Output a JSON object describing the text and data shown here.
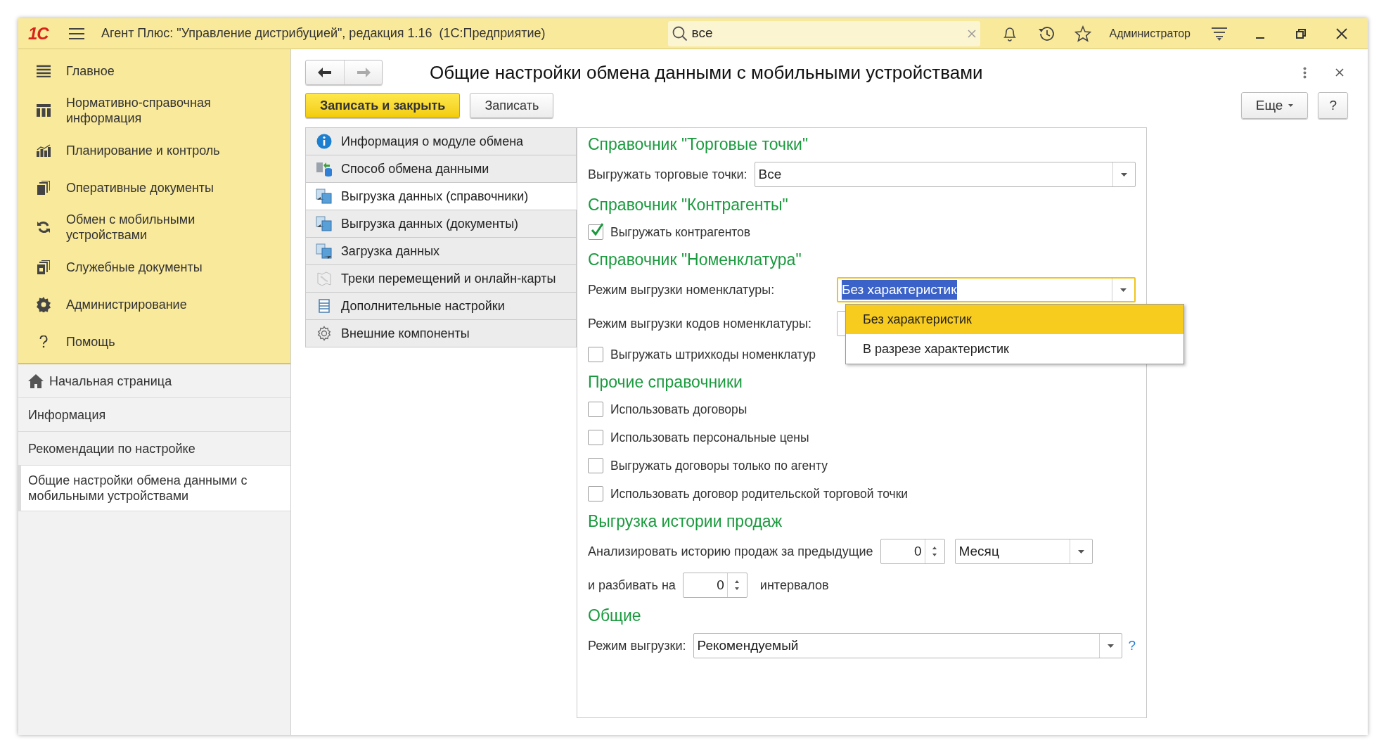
{
  "title_bar": {
    "logo": "1С",
    "app_title": "Агент Плюс: \"Управление дистрибуцией\", редакция 1.16  (1С:Предприятие)",
    "search": {
      "value": "все"
    },
    "user": "Администратор"
  },
  "sidebar": {
    "sections": [
      {
        "label": "Главное"
      },
      {
        "label": "Нормативно-справочная информация"
      },
      {
        "label": "Планирование и контроль"
      },
      {
        "label": "Оперативные документы"
      },
      {
        "label": "Обмен с мобильными устройствами"
      },
      {
        "label": "Служебные документы"
      },
      {
        "label": "Администрирование"
      },
      {
        "label": "Помощь"
      }
    ],
    "open_pages": [
      {
        "label": "Начальная страница",
        "selected": false
      },
      {
        "label": "Информация",
        "selected": false
      },
      {
        "label": "Рекомендации по настройке",
        "selected": false
      },
      {
        "label": "Общие настройки обмена данными с мобильными устройствами",
        "selected": true
      }
    ]
  },
  "form": {
    "title": "Общие настройки обмена данными с мобильными устройствами",
    "nav": [
      {
        "kind": "back",
        "disabled": false
      },
      {
        "kind": "forward",
        "disabled": true
      }
    ],
    "buttons": [
      {
        "label": "Записать и закрыть",
        "primary": true
      },
      {
        "label": "Записать",
        "primary": false
      }
    ],
    "right_buttons": [
      {
        "label": "Еще",
        "menu": true
      },
      {
        "label": "?",
        "menu": false
      }
    ],
    "tabs": [
      {
        "label": "Информация о модуле обмена",
        "selected": false
      },
      {
        "label": "Способ обмена данными",
        "selected": false
      },
      {
        "label": "Выгрузка данных (справочники)",
        "selected": true
      },
      {
        "label": "Выгрузка данных (документы)",
        "selected": false
      },
      {
        "label": "Загрузка данных",
        "selected": false
      },
      {
        "label": "Треки перемещений и онлайн-карты",
        "selected": false
      },
      {
        "label": "Дополнительные настройки",
        "selected": false
      },
      {
        "label": "Внешние компоненты",
        "selected": false
      }
    ],
    "rows": [
      {
        "kind": "heading",
        "text": "Справочник \"Торговые точки\""
      },
      {
        "kind": "line",
        "items": [
          {
            "kind": "label",
            "text": "Выгружать торговые точки:"
          },
          {
            "kind": "select",
            "value": "Все",
            "focused": false
          }
        ]
      },
      {
        "kind": "heading",
        "text": "Справочник \"Контрагенты\""
      },
      {
        "kind": "checkbox",
        "text": "Выгружать контрагентов",
        "checked": true
      },
      {
        "kind": "heading",
        "text": "Справочник \"Номенклатура\""
      },
      {
        "kind": "line",
        "items": [
          {
            "kind": "label",
            "text": "Режим выгрузки номенклатуры:"
          },
          {
            "kind": "select",
            "value": "Без характеристик",
            "focused": true,
            "options": [
              {
                "label": "Без характеристик",
                "selected": true
              },
              {
                "label": "В разрезе характеристик",
                "selected": false
              }
            ]
          }
        ]
      },
      {
        "kind": "line",
        "items": [
          {
            "kind": "label",
            "text": "Режим выгрузки кодов номенклатуры:"
          },
          {
            "kind": "select",
            "focused": false
          }
        ]
      },
      {
        "kind": "checkbox",
        "text": "Выгружать штрихкоды номенклатур",
        "checked": false
      },
      {
        "kind": "heading",
        "text": "Прочие справочники"
      },
      {
        "kind": "checkbox",
        "text": "Использовать договоры",
        "checked": false
      },
      {
        "kind": "checkbox",
        "text": "Использовать персональные цены",
        "checked": false
      },
      {
        "kind": "checkbox",
        "text": "Выгружать договоры только по агенту",
        "checked": false
      },
      {
        "kind": "checkbox",
        "text": "Использовать договор родительской торговой точки",
        "checked": false
      },
      {
        "kind": "heading",
        "text": "Выгрузка истории продаж"
      },
      {
        "kind": "line",
        "items": [
          {
            "kind": "label",
            "text": "Анализировать историю продаж за предыдущие"
          },
          {
            "kind": "spin",
            "value": "0"
          },
          {
            "kind": "select",
            "value": "Месяц",
            "focused": false
          }
        ]
      },
      {
        "kind": "line",
        "items": [
          {
            "kind": "label",
            "text": "и разбивать на"
          },
          {
            "kind": "spin",
            "value": "0"
          },
          {
            "kind": "label",
            "text": "интервалов"
          }
        ]
      },
      {
        "kind": "heading",
        "text": "Общие"
      },
      {
        "kind": "line",
        "items": [
          {
            "kind": "label",
            "text": "Режим выгрузки:"
          },
          {
            "kind": "select",
            "value": "Рекомендуемый",
            "focused": false
          },
          {
            "kind": "help",
            "text": "?"
          }
        ]
      }
    ]
  }
}
